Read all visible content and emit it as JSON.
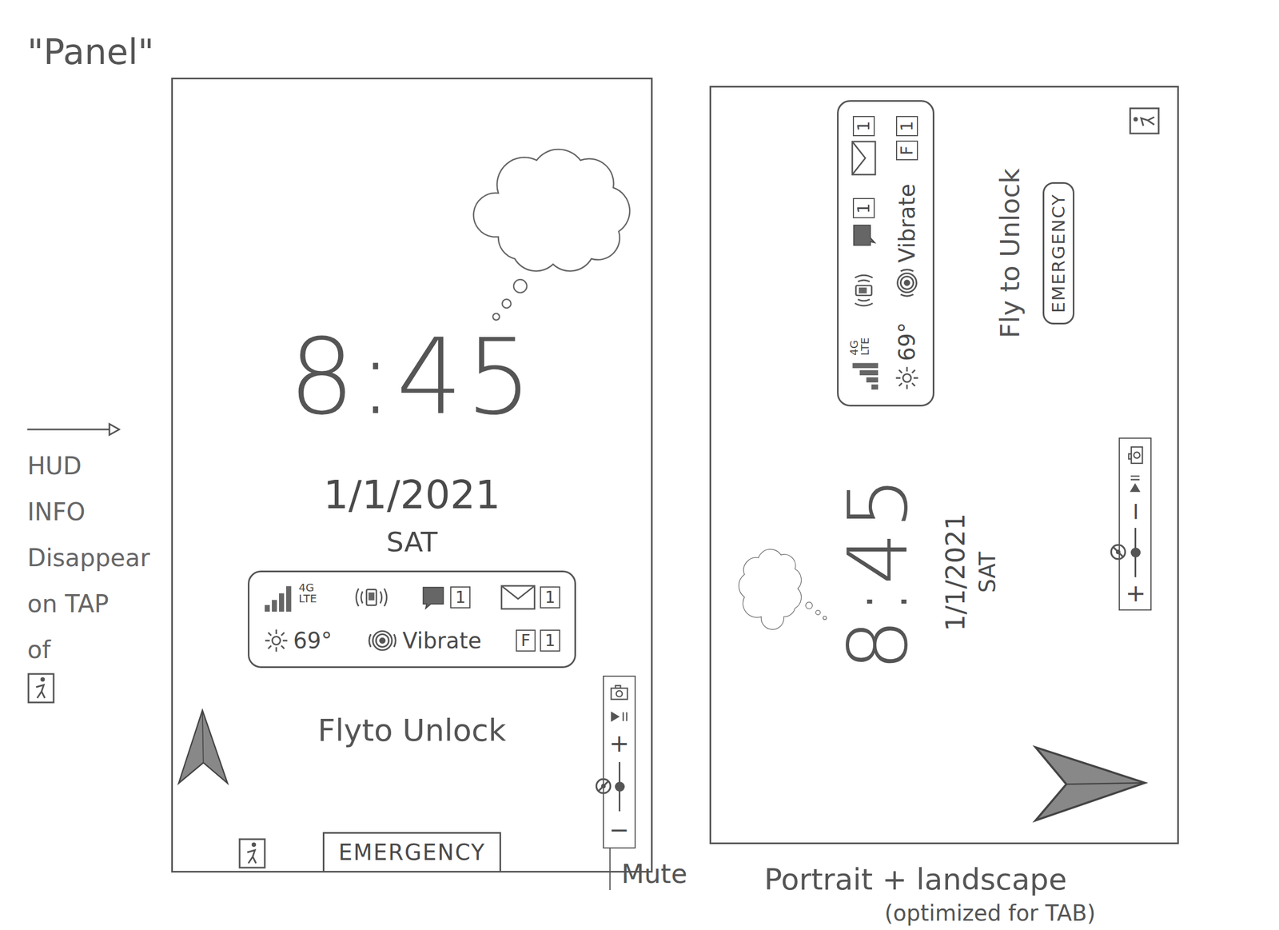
{
  "title": "\"Panel\"",
  "annotation": [
    "HUD",
    "INFO",
    "Disappear",
    "on TAP",
    "of"
  ],
  "portrait": {
    "time": "8:45",
    "date": "1/1/2021",
    "day": "SAT",
    "hud": {
      "network": "4G LTE",
      "messages": "1",
      "email": "1",
      "temperature": "69°",
      "ring_mode": "Vibrate",
      "badge": "F",
      "badge_count": "1"
    },
    "unlock": "Flyto Unlock",
    "emergency": "EMERGENCY",
    "volume": {
      "plus": "+",
      "minus": "−",
      "level": 0.5
    },
    "mute_label": "Mute"
  },
  "landscape": {
    "time": "8:45",
    "date": "1/1/2021",
    "day": "SAT",
    "hud": {
      "network": "4G LTE",
      "messages": "1",
      "email": "1",
      "temperature": "69°",
      "ring_mode": "Vibrate",
      "badge": "F",
      "badge_count": "1"
    },
    "unlock": "Fly to Unlock",
    "emergency": "EMERGENCY",
    "volume": {
      "plus": "+",
      "minus": "−",
      "level": 0.5
    }
  },
  "caption": "Portrait + landscape",
  "caption_note": "(optimized for TAB)"
}
